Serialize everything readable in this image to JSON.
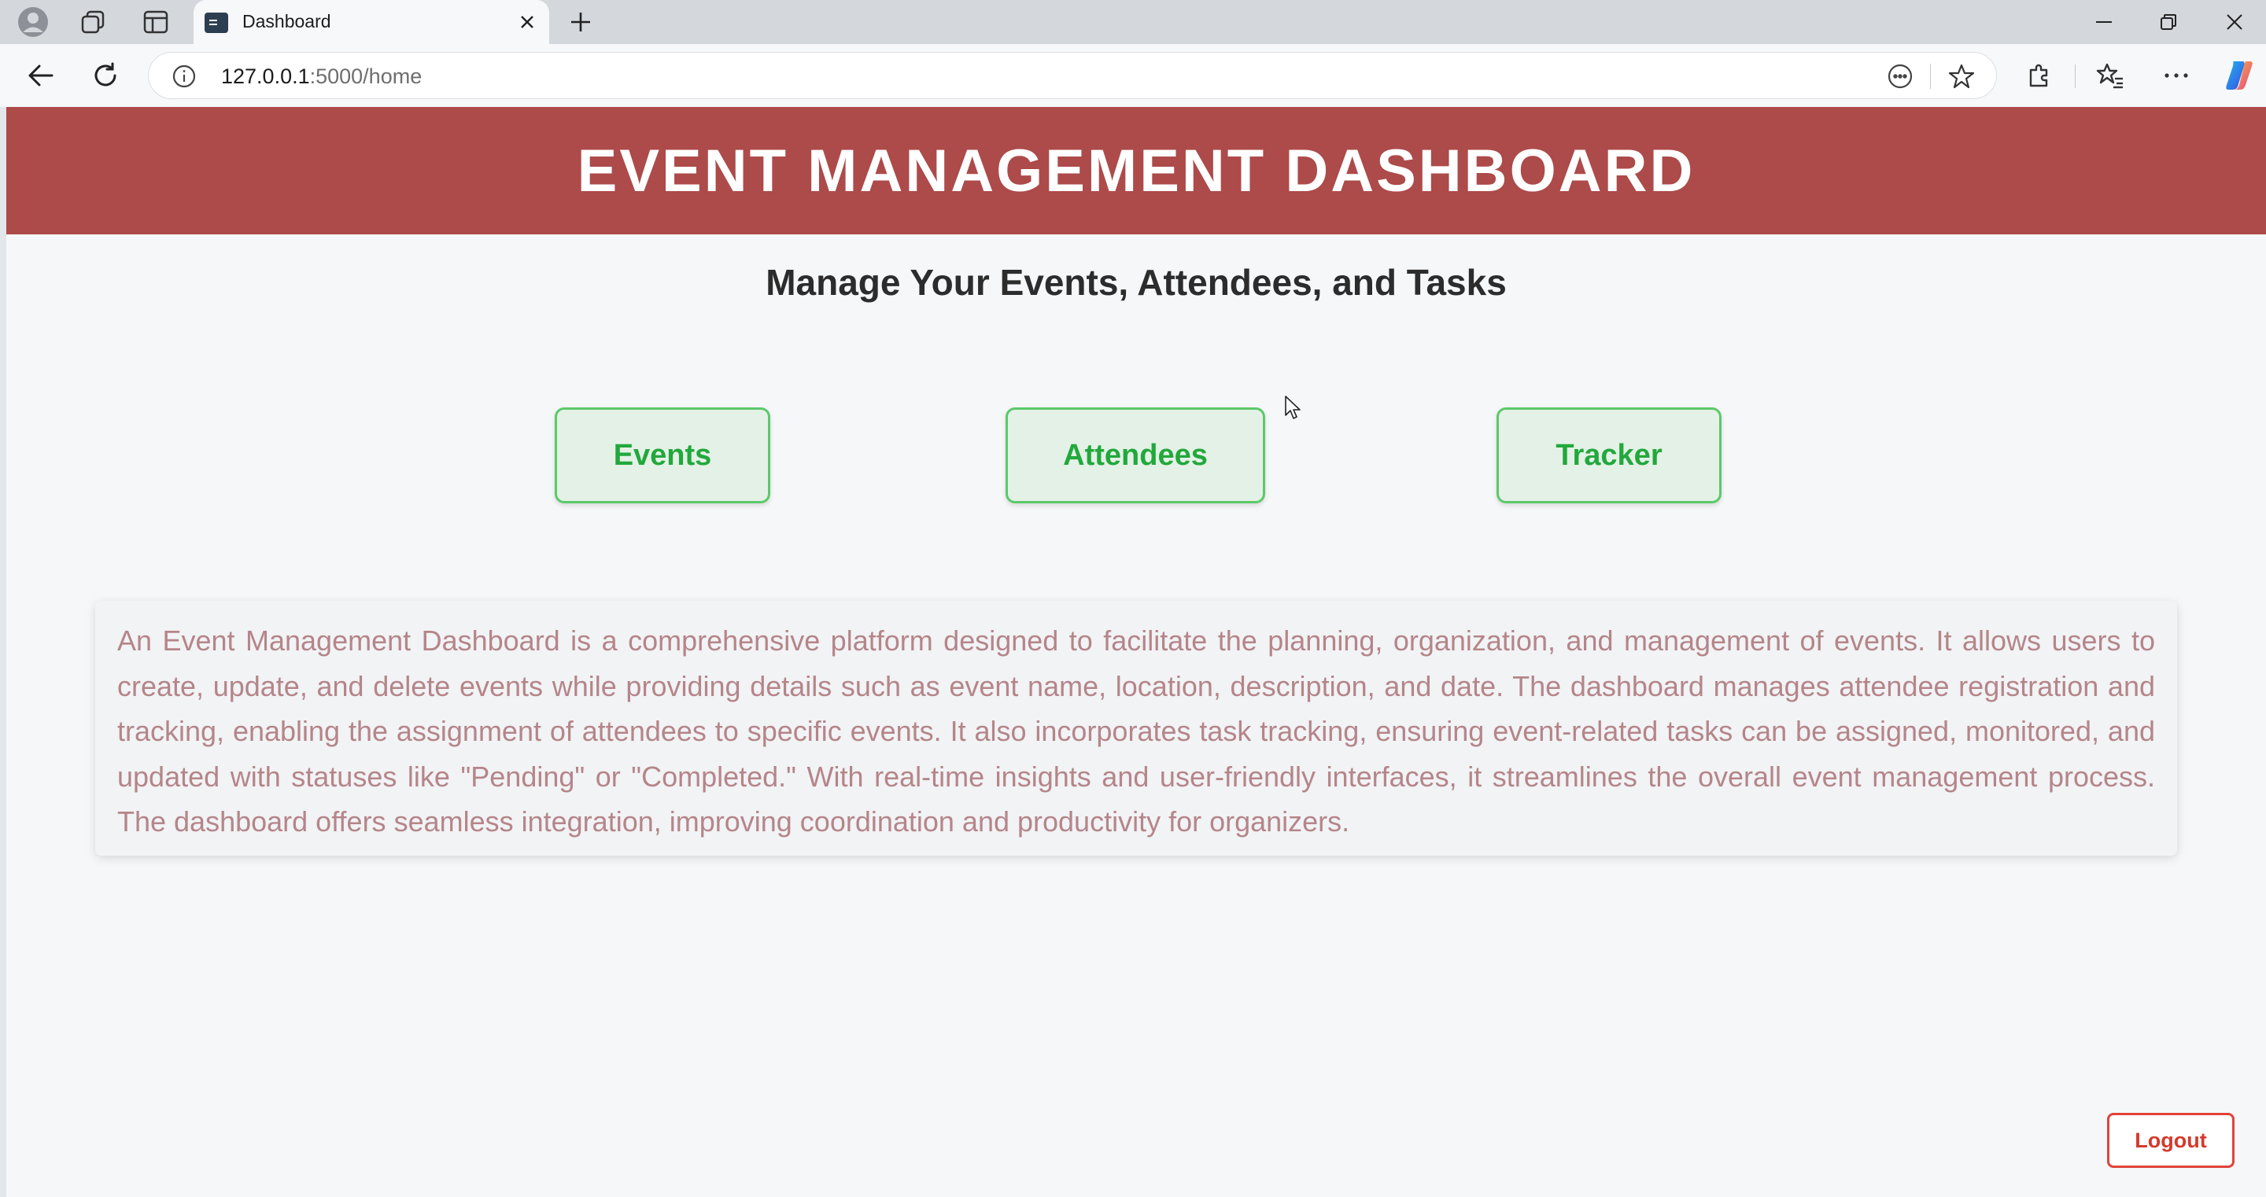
{
  "browser": {
    "tab_title": "Dashboard",
    "url_host": "127.0.0.1",
    "url_rest": ":5000/home"
  },
  "header": {
    "title": "EVENT MANAGEMENT DASHBOARD"
  },
  "main": {
    "subtitle": "Manage Your Events, Attendees, and Tasks",
    "nav_buttons": [
      {
        "label": "Events"
      },
      {
        "label": "Attendees"
      },
      {
        "label": "Tracker"
      }
    ],
    "description": "An Event Management Dashboard is a comprehensive platform designed to facilitate the planning, organization, and management of events. It allows users to create, update, and delete events while providing details such as event name, location, description, and date. The dashboard manages attendee registration and tracking, enabling the assignment of attendees to specific events. It also incorporates task tracking, ensuring event-related tasks can be assigned, monitored, and updated with statuses like \"Pending\" or \"Completed.\" With real-time insights and user-friendly interfaces, it streamlines the overall event management process. The dashboard offers seamless integration, improving coordination and productivity for organizers.",
    "logout_label": "Logout"
  },
  "icons": [
    "profile-icon",
    "workspaces-icon",
    "vertical-tabs-icon",
    "terminal-favicon-icon",
    "close-tab-icon",
    "new-tab-icon",
    "minimize-icon",
    "restore-icon",
    "close-window-icon",
    "back-icon",
    "refresh-icon",
    "site-info-icon",
    "read-aloud-icon",
    "favorite-star-icon",
    "extensions-icon",
    "favorites-icon",
    "more-options-icon",
    "copilot-icon",
    "mouse-cursor-icon"
  ],
  "colors": {
    "header_bg": "#ad4a4a",
    "nav_button_bg": "#e4f1e6",
    "nav_button_border": "#5cc96a",
    "nav_button_text": "#22a83c",
    "description_text": "#b58589",
    "logout_border": "#e0433a"
  }
}
